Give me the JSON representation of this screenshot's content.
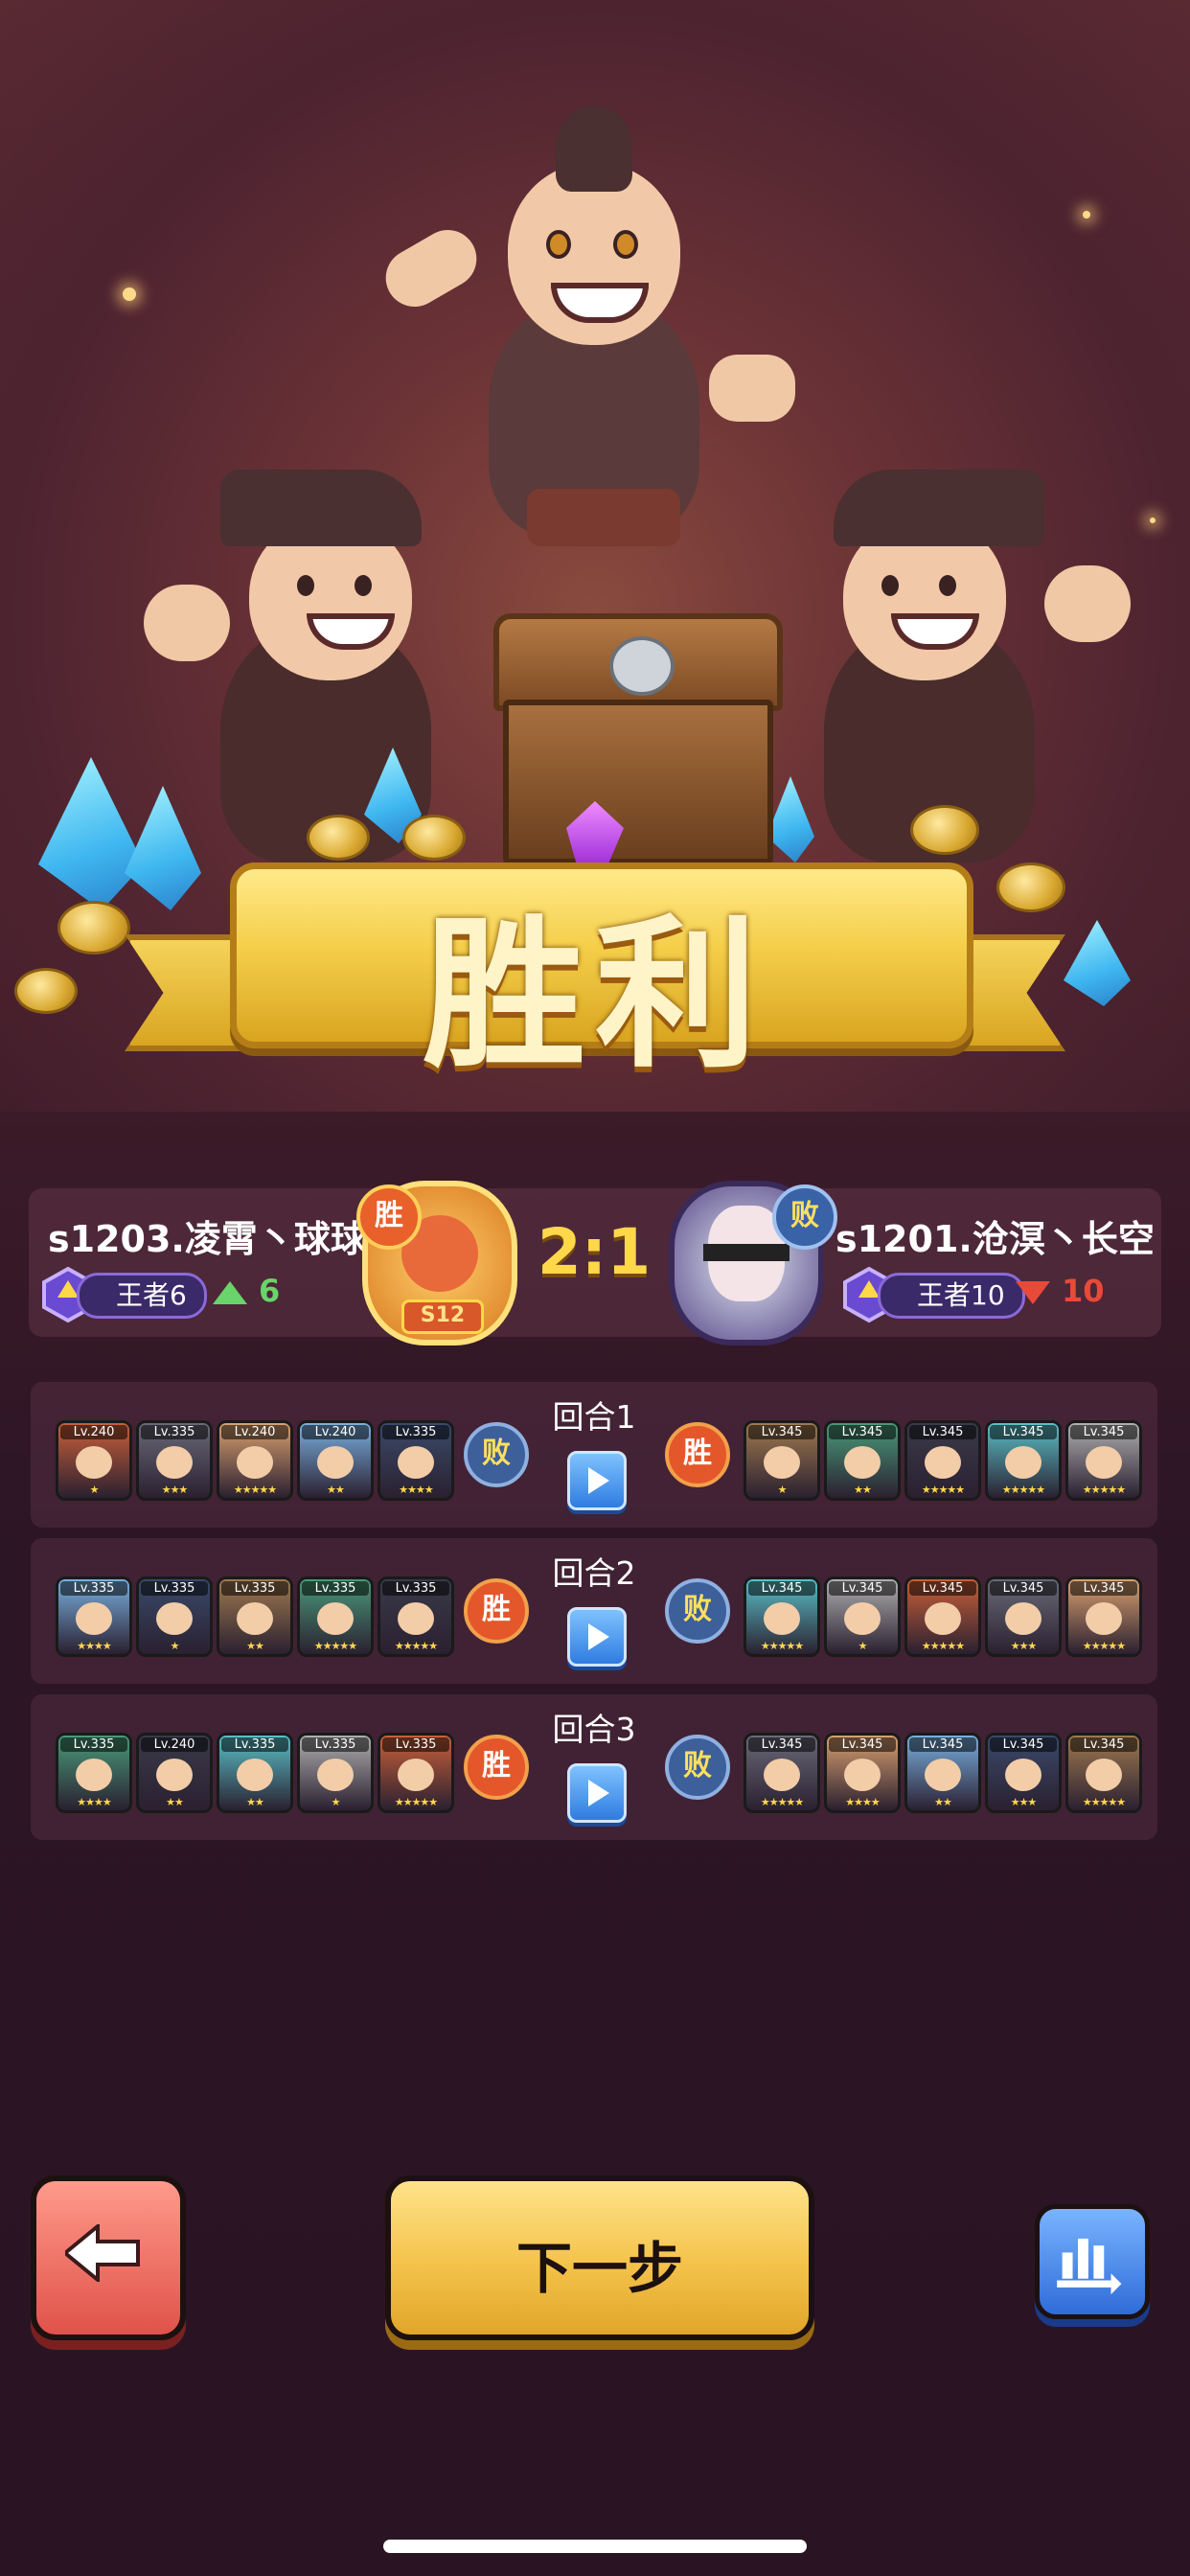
{
  "title": "胜利",
  "players": {
    "left": {
      "name": "s1203.凌霄丶球球",
      "rank": "王者6",
      "delta": "6",
      "result_tag": "胜",
      "badge_text": "S12"
    },
    "right": {
      "name": "s1201.沧溟丶长空",
      "rank": "王者10",
      "delta": "10",
      "result_tag": "败"
    }
  },
  "score": "2:1",
  "rounds": [
    {
      "label": "回合1",
      "left_result": "败",
      "right_result": "胜",
      "left_heroes": [
        {
          "lv": "Lv.240",
          "stars": "★"
        },
        {
          "lv": "Lv.335",
          "stars": "★★★"
        },
        {
          "lv": "Lv.240",
          "stars": "★★★★★"
        },
        {
          "lv": "Lv.240",
          "stars": "★★"
        },
        {
          "lv": "Lv.335",
          "stars": "★★★★"
        }
      ],
      "right_heroes": [
        {
          "lv": "Lv.345",
          "stars": "★"
        },
        {
          "lv": "Lv.345",
          "stars": "★★"
        },
        {
          "lv": "Lv.345",
          "stars": "★★★★★"
        },
        {
          "lv": "Lv.345",
          "stars": "★★★★★"
        },
        {
          "lv": "Lv.345",
          "stars": "★★★★★"
        }
      ]
    },
    {
      "label": "回合2",
      "left_result": "胜",
      "right_result": "败",
      "left_heroes": [
        {
          "lv": "Lv.335",
          "stars": "★★★★"
        },
        {
          "lv": "Lv.335",
          "stars": "★"
        },
        {
          "lv": "Lv.335",
          "stars": "★★"
        },
        {
          "lv": "Lv.335",
          "stars": "★★★★★"
        },
        {
          "lv": "Lv.335",
          "stars": "★★★★★"
        }
      ],
      "right_heroes": [
        {
          "lv": "Lv.345",
          "stars": "★★★★★"
        },
        {
          "lv": "Lv.345",
          "stars": "★"
        },
        {
          "lv": "Lv.345",
          "stars": "★★★★★"
        },
        {
          "lv": "Lv.345",
          "stars": "★★★"
        },
        {
          "lv": "Lv.345",
          "stars": "★★★★★"
        }
      ]
    },
    {
      "label": "回合3",
      "left_result": "胜",
      "right_result": "败",
      "left_heroes": [
        {
          "lv": "Lv.335",
          "stars": "★★★★"
        },
        {
          "lv": "Lv.240",
          "stars": "★★"
        },
        {
          "lv": "Lv.335",
          "stars": "★★"
        },
        {
          "lv": "Lv.335",
          "stars": "★"
        },
        {
          "lv": "Lv.335",
          "stars": "★★★★★"
        }
      ],
      "right_heroes": [
        {
          "lv": "Lv.345",
          "stars": "★★★★★"
        },
        {
          "lv": "Lv.345",
          "stars": "★★★★"
        },
        {
          "lv": "Lv.345",
          "stars": "★★"
        },
        {
          "lv": "Lv.345",
          "stars": "★★★"
        },
        {
          "lv": "Lv.345",
          "stars": "★★★★★"
        }
      ]
    }
  ],
  "buttons": {
    "back_icon": "arrow-left-icon",
    "next_label": "下一步",
    "stats_icon": "bar-chart-icon"
  },
  "colors": {
    "gold": "#ffd84a",
    "win": "#e4572a",
    "lose": "#3d5f9a",
    "up": "#69d46a",
    "down": "#e84a3a"
  },
  "hero_portrait_colors": [
    "#c9603a",
    "#6a6a78",
    "#d9a070",
    "#7ab0e0",
    "#3a4a6a",
    "#a07a50",
    "#4a9a7a",
    "#3a3a4a",
    "#5ac0c8",
    "#b0b0b0"
  ]
}
